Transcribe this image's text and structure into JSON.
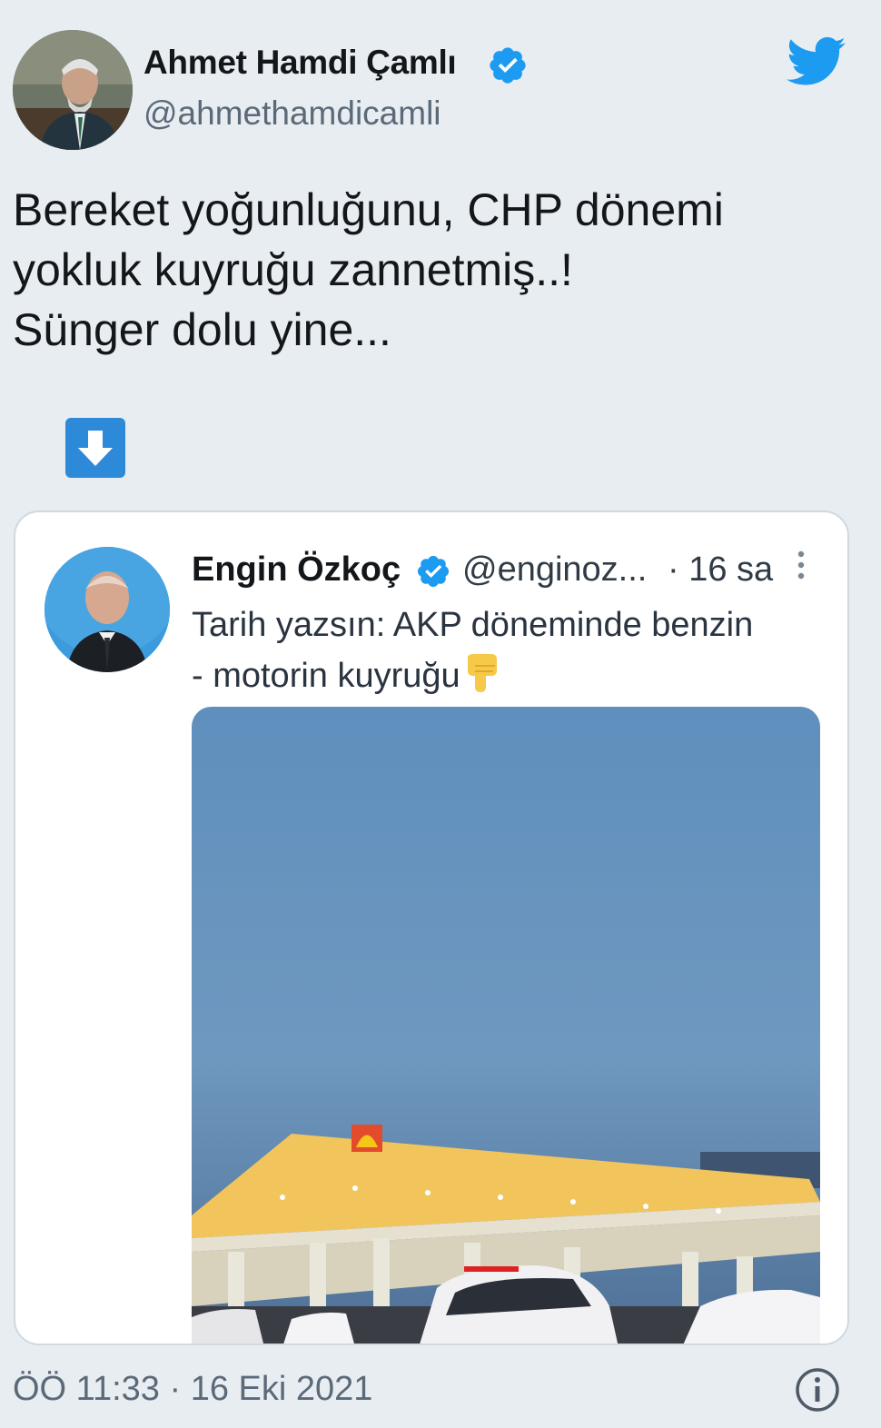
{
  "author": {
    "name": "Ahmet Hamdi Çamlı",
    "handle": "@ahmethamdicamli",
    "avatar_icon": "person-photo-icon",
    "verified_icon": "verified-badge-icon"
  },
  "header": {
    "logo_icon": "twitter-bird-icon"
  },
  "tweet": {
    "lines": [
      "Bereket yoğunluğunu, CHP dönemi",
      "yokluk kuyruğu zannetmiş..!",
      "Sünger dolu yine..."
    ],
    "emoji_icon": "down-arrow-icon"
  },
  "quote": {
    "name": "Engin Özkoç",
    "handle": "@enginoz...",
    "time": "· 16 sa",
    "lines": [
      "Tarih yazsın: AKP döneminde benzin",
      "- motorin kuyruğu"
    ],
    "emoji_icon": "pointing-down-hand-icon",
    "more_icon": "more-vertical-icon",
    "image_icon": "gas-station-photo"
  },
  "footer": {
    "timestamp": "ÖÖ 11:33 · 16 Eki 2021",
    "info_icon": "info-icon"
  },
  "colors": {
    "background": "#e8edf2",
    "twitter_blue": "#1d9bf0",
    "text_primary": "#14171a",
    "text_secondary": "#5b6a78"
  }
}
